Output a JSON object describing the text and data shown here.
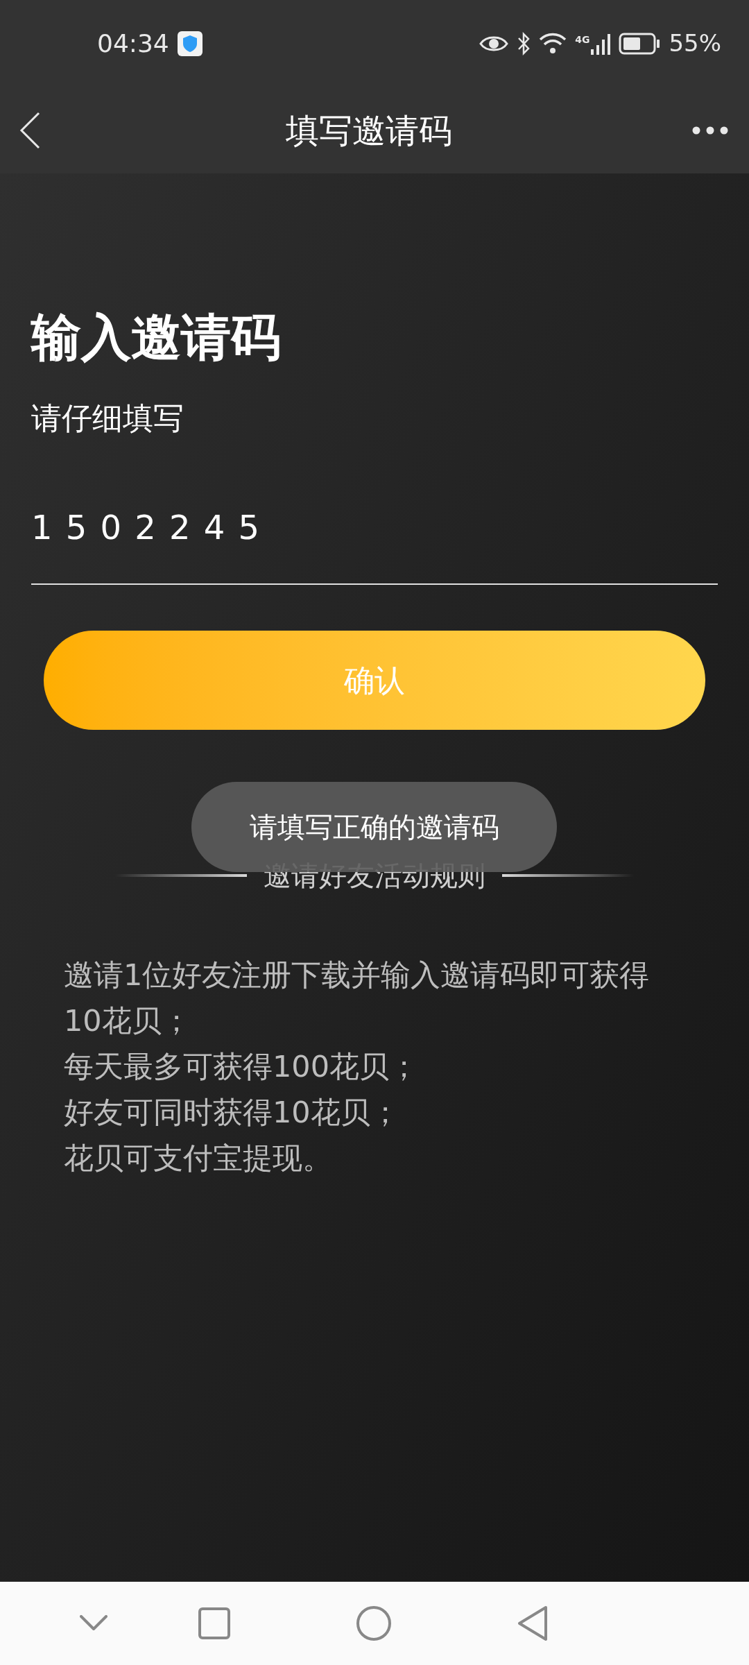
{
  "status_bar": {
    "time": "04:34",
    "battery": "55%",
    "network": "4G"
  },
  "header": {
    "title": "填写邀请码"
  },
  "form": {
    "heading": "输入邀请码",
    "subheading": "请仔细填写",
    "code_value": "1502245",
    "confirm_button": "确认"
  },
  "toast": {
    "message": "请填写正确的邀请码"
  },
  "rules": {
    "heading": "邀请好友活动规则",
    "lines": [
      "邀请1位好友注册下载并输入邀请码即可获得10花贝；",
      "每天最多可获得100花贝；",
      "好友可同时获得10花贝；",
      "花贝可支付宝提现。"
    ]
  }
}
